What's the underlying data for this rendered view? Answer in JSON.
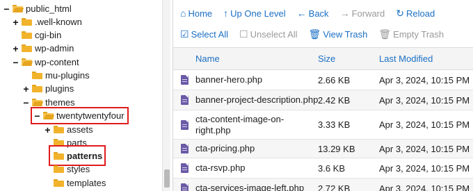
{
  "tree": {
    "items": [
      {
        "label": "public_html",
        "toggle": "−",
        "open": true
      },
      {
        "label": ".well-known",
        "toggle": "+",
        "open": false
      },
      {
        "label": "cgi-bin",
        "toggle": "",
        "open": false
      },
      {
        "label": "wp-admin",
        "toggle": "+",
        "open": false
      },
      {
        "label": "wp-content",
        "toggle": "−",
        "open": true
      },
      {
        "label": "mu-plugins",
        "toggle": "",
        "open": false
      },
      {
        "label": "plugins",
        "toggle": "+",
        "open": false
      },
      {
        "label": "themes",
        "toggle": "−",
        "open": true
      },
      {
        "label": "twentytwentyfour",
        "toggle": "−",
        "open": true
      },
      {
        "label": "assets",
        "toggle": "+",
        "open": false
      },
      {
        "label": "parts",
        "toggle": "",
        "open": false
      },
      {
        "label": "patterns",
        "toggle": "",
        "open": false
      },
      {
        "label": "styles",
        "toggle": "",
        "open": false
      },
      {
        "label": "templates",
        "toggle": "",
        "open": false
      }
    ]
  },
  "toolbar": {
    "home": "Home",
    "up_one_level": "Up One Level",
    "back": "Back",
    "forward": "Forward",
    "reload": "Reload",
    "select_all": "Select All",
    "unselect_all": "Unselect All",
    "view_trash": "View Trash",
    "empty_trash": "Empty Trash"
  },
  "table": {
    "headers": {
      "name": "Name",
      "size": "Size",
      "modified": "Last Modified"
    },
    "rows": [
      {
        "name": "banner-hero.php",
        "size": "2.66 KB",
        "modified": "Apr 3, 2024, 10:15 PM"
      },
      {
        "name": "banner-project-description.php",
        "size": "2.42 KB",
        "modified": "Apr 3, 2024, 10:15 PM"
      },
      {
        "name": "cta-content-image-on-right.php",
        "size": "3.33 KB",
        "modified": "Apr 3, 2024, 10:15 PM"
      },
      {
        "name": "cta-pricing.php",
        "size": "13.29 KB",
        "modified": "Apr 3, 2024, 10:15 PM"
      },
      {
        "name": "cta-rsvp.php",
        "size": "3.6 KB",
        "modified": "Apr 3, 2024, 10:15 PM"
      },
      {
        "name": "cta-services-image-left.php",
        "size": "2.72 KB",
        "modified": "Apr 3, 2024, 10:15 PM"
      }
    ]
  },
  "colors": {
    "link": "#1a6fc4",
    "highlight": "#e01b1b",
    "folder": "#f2b32c",
    "php_icon": "#6a5aa6"
  }
}
